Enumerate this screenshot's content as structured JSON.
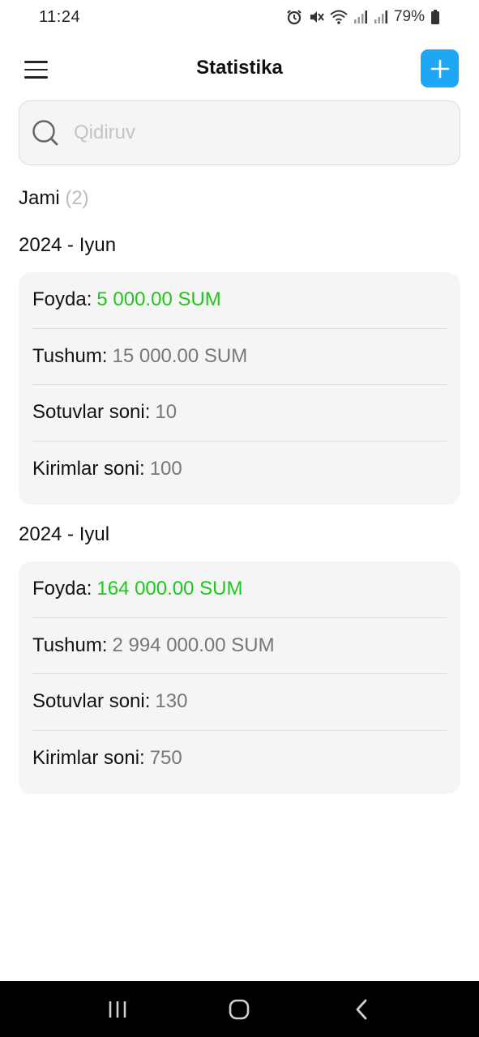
{
  "status_bar": {
    "time": "11:24",
    "battery": "79%",
    "icons": [
      "alarm-icon",
      "mute-icon",
      "wifi-icon",
      "signal-icon",
      "signal-icon",
      "battery-icon"
    ]
  },
  "header": {
    "title": "Statistika",
    "menu_icon": "hamburger-menu-icon",
    "add_icon": "plus-icon"
  },
  "search": {
    "placeholder": "Qidiruv",
    "value": ""
  },
  "total": {
    "label": "Jami",
    "count": "(2)"
  },
  "months": [
    {
      "title": "2024 - Iyun",
      "rows": [
        {
          "label": "Foyda:",
          "value": "5 000.00 SUM"
        },
        {
          "label": "Tushum:",
          "value": "15 000.00 SUM"
        },
        {
          "label": "Sotuvlar soni:",
          "value": "10"
        },
        {
          "label": "Kirimlar soni:",
          "value": "100"
        }
      ]
    },
    {
      "title": "2024 - Iyul",
      "rows": [
        {
          "label": "Foyda:",
          "value": "164 000.00 SUM"
        },
        {
          "label": "Tushum:",
          "value": "2 994 000.00 SUM"
        },
        {
          "label": "Sotuvlar soni:",
          "value": "130"
        },
        {
          "label": "Kirimlar soni:",
          "value": "750"
        }
      ]
    }
  ],
  "colors": {
    "accent": "#1ea7f5",
    "profit_green": "#1ec71e",
    "card_bg": "#f5f5f5",
    "muted_value": "#777777"
  },
  "nav_bar": {
    "icons": [
      "recent-apps-icon",
      "home-icon",
      "back-icon"
    ]
  }
}
